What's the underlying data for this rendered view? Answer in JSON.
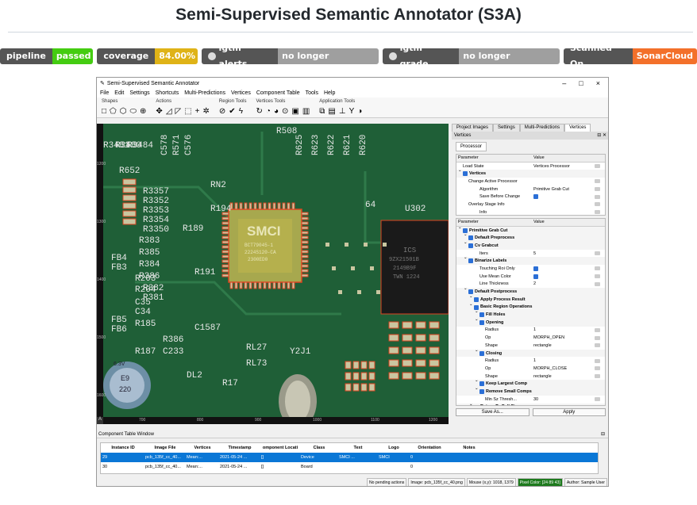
{
  "page": {
    "title": "Semi-Supervised Semantic Annotator (S3A)"
  },
  "badges": [
    {
      "label": "pipeline",
      "value": "passed",
      "color": "#4c1"
    },
    {
      "label": "coverage",
      "value": "84.00%",
      "color": "#dfb317"
    },
    {
      "label": "lgtm alerts",
      "value": "no longer available",
      "color": "#9f9f9f"
    },
    {
      "label": "lgtm grade",
      "value": "no longer available",
      "color": "#9f9f9f"
    },
    {
      "label": "Scanned On",
      "value": "SonarCloud",
      "color": "#f3702a"
    }
  ],
  "app": {
    "window_title": "Semi-Supervised Semantic Annotator",
    "menu": [
      "File",
      "Edit",
      "Settings",
      "Shortcuts",
      "Multi-Predictions",
      "Vertices",
      "Component Table",
      "Tools",
      "Help"
    ],
    "toolbar_groups": [
      {
        "label": "Shapes",
        "icons": [
          "□",
          "⬠",
          "⬡",
          "⬭",
          "⊕"
        ]
      },
      {
        "label": "Actions",
        "icons": [
          "✥",
          "◿",
          "◸",
          "⬚",
          "+",
          "✲"
        ]
      },
      {
        "label": "Region Tools",
        "icons": [
          "⊘",
          "✔",
          "ϟ"
        ]
      },
      {
        "label": "Vertices Tools",
        "icons": [
          "↻",
          "◔",
          "◕",
          "⊙",
          "▣",
          "▥"
        ]
      },
      {
        "label": "Application Tools",
        "icons": [
          "⧉",
          "▤",
          "⊥",
          "Y",
          "◑"
        ]
      }
    ],
    "y_ticks": [
      "1200",
      "1300",
      "1400",
      "1500",
      "1600"
    ],
    "x_ticks": [
      "700",
      "800",
      "900",
      "1000",
      "1100",
      "1200"
    ],
    "right_tabs": [
      "Project Images",
      "Settings",
      "Multi-Predictions",
      "Vertices"
    ],
    "dock_title": "Vertices",
    "sub_tab": "Processor",
    "top_table": {
      "header": [
        "Parameter",
        "Value"
      ],
      "rows": [
        {
          "k": "Load State",
          "v": "Vertices Processor",
          "d": 0,
          "bold": false
        },
        {
          "k": "Vertices",
          "v": "",
          "d": 0,
          "bold": true
        },
        {
          "k": "Change Active Processor",
          "v": "",
          "d": 1,
          "bold": false
        },
        {
          "k": "Algorithm",
          "v": "Primitive Grab Cut",
          "d": 3,
          "bold": false
        },
        {
          "k": "Save Before Change",
          "v": "✓",
          "d": 3,
          "bold": false
        },
        {
          "k": "Overlay Stage Info",
          "v": "",
          "d": 1,
          "bold": false
        },
        {
          "k": "Info",
          "v": "",
          "d": 3,
          "bold": false
        }
      ]
    },
    "bottom_table": {
      "header": [
        "Parameter",
        "Value"
      ],
      "rows": [
        {
          "k": "Primitive Grab Cut",
          "v": "",
          "d": 0,
          "bold": true
        },
        {
          "k": "Default Preprocess",
          "v": "",
          "d": 1,
          "bold": true
        },
        {
          "k": "Cv Grabcut",
          "v": "",
          "d": 1,
          "bold": true
        },
        {
          "k": "Iters",
          "v": "5",
          "d": 3,
          "bold": false
        },
        {
          "k": "Binarize Labels",
          "v": "",
          "d": 1,
          "bold": true
        },
        {
          "k": "Touching Roi Only",
          "v": "✓",
          "d": 3,
          "bold": false
        },
        {
          "k": "Use Mean Color",
          "v": "✓",
          "d": 3,
          "bold": false
        },
        {
          "k": "Line Thickness",
          "v": "2",
          "d": 3,
          "bold": false
        },
        {
          "k": "Default Postprocess",
          "v": "",
          "d": 1,
          "bold": true
        },
        {
          "k": "Apply Process Result",
          "v": "",
          "d": 2,
          "bold": true
        },
        {
          "k": "Basic Region Operations",
          "v": "",
          "d": 2,
          "bold": true
        },
        {
          "k": "Fill Holes",
          "v": "",
          "d": 3,
          "bold": true
        },
        {
          "k": "Opening",
          "v": "",
          "d": 3,
          "bold": true
        },
        {
          "k": "Radius",
          "v": "1",
          "d": 4,
          "bold": false
        },
        {
          "k": "Op",
          "v": "MORPH_OPEN",
          "d": 4,
          "bold": false
        },
        {
          "k": "Shape",
          "v": "rectangle",
          "d": 4,
          "bold": false
        },
        {
          "k": "Closing",
          "v": "",
          "d": 3,
          "bold": true
        },
        {
          "k": "Radius",
          "v": "1",
          "d": 4,
          "bold": false
        },
        {
          "k": "Op",
          "v": "MORPH_CLOSE",
          "d": 4,
          "bold": false
        },
        {
          "k": "Shape",
          "v": "rectangle",
          "d": 4,
          "bold": false
        },
        {
          "k": "Keep Largest Comp",
          "v": "",
          "d": 3,
          "bold": true
        },
        {
          "k": "Remove Small Comps",
          "v": "",
          "d": 3,
          "bold": true
        },
        {
          "k": "Min Sz Thresh...",
          "v": "30",
          "d": 4,
          "bold": false
        },
        {
          "k": "Return To Full Size",
          "v": "",
          "d": 2,
          "bold": true
        }
      ]
    },
    "buttons": {
      "save_as": "Save As...",
      "apply": "Apply"
    },
    "component_window": {
      "title": "Component Table Window",
      "columns": [
        "Instance ID",
        "Image File",
        "Vertices",
        "Timestamp",
        "omponent Locati",
        "Class",
        "Text",
        "Logo",
        "Orientation",
        "Notes"
      ],
      "rows": [
        [
          "29",
          "pcb_135f_cc_40...",
          "Mean:...",
          "2021-05-24 ...",
          "[]",
          "Device",
          "SMCI ...",
          "SMCI",
          "0",
          ""
        ],
        [
          "30",
          "pcb_135f_cc_40...",
          "Mean:...",
          "2021-05-24 ...",
          "[]",
          "Board",
          "",
          "",
          "0",
          ""
        ]
      ]
    },
    "status": {
      "actions": "No pending actions",
      "image": "Image: pcb_135f_cc_40.png",
      "mouse": "Mouse (x,y): 1018, 1379",
      "pixel": "Pixel Color: [24 89 43]",
      "author": "Author: Sample User"
    },
    "pcb_labels": [
      "R508",
      "R625",
      "R623",
      "R622",
      "R621",
      "R620",
      "C578",
      "R571",
      "C576",
      "R652",
      "R3481",
      "R3480",
      "R3484",
      "R3357",
      "R3352",
      "R3353",
      "R3354",
      "R3350",
      "R383",
      "R385",
      "R384",
      "R386",
      "R382",
      "R381",
      "C1587",
      "R185",
      "R386",
      "C233",
      "R187",
      "R189",
      "R191",
      "R194",
      "RN2",
      "DL2",
      "R17",
      "RL27",
      "RL73",
      "Y2J1",
      "C35",
      "C34",
      "R203",
      "R204",
      "FB5",
      "FB6",
      "FB4",
      "FB3",
      "U302",
      "64",
      "SMCI"
    ],
    "chip_text": [
      "SMCI",
      "BCT79045-1",
      "2224S120-CA",
      "2300ED0"
    ],
    "right_chip_text": [
      "ICS",
      "9ZX21501B",
      "2149B9F",
      "TWN 1224"
    ],
    "cap_text": [
      "6.3V",
      "E9",
      "220"
    ]
  }
}
